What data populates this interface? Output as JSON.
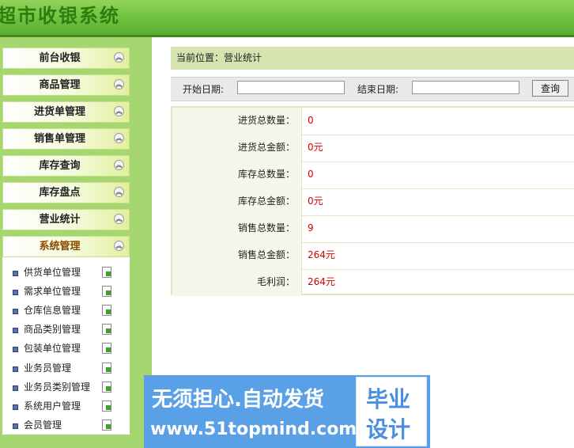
{
  "header": {
    "title": "超市收银系统"
  },
  "sidebar": {
    "items": [
      {
        "label": "前台收银"
      },
      {
        "label": "商品管理"
      },
      {
        "label": "进货单管理"
      },
      {
        "label": "销售单管理"
      },
      {
        "label": "库存查询"
      },
      {
        "label": "库存盘点"
      },
      {
        "label": "营业统计"
      },
      {
        "label": "系统管理"
      }
    ],
    "toggle_glyph": "︽",
    "submenu": [
      {
        "label": "供货单位管理"
      },
      {
        "label": "需求单位管理"
      },
      {
        "label": "仓库信息管理"
      },
      {
        "label": "商品类别管理"
      },
      {
        "label": "包装单位管理"
      },
      {
        "label": "业务员管理"
      },
      {
        "label": "业务员类别管理"
      },
      {
        "label": "系统用户管理"
      },
      {
        "label": "会员管理"
      }
    ]
  },
  "breadcrumb": "当前位置：营业统计",
  "search": {
    "start_label": "开始日期:",
    "end_label": "结束日期:",
    "start_value": "",
    "end_value": "",
    "button": "查询"
  },
  "stats": [
    {
      "label": "进货总数量：",
      "value": "0"
    },
    {
      "label": "进货总金额：",
      "value": "0元"
    },
    {
      "label": "库存总数量：",
      "value": "0"
    },
    {
      "label": "库存总金额：",
      "value": "0元"
    },
    {
      "label": "销售总数量：",
      "value": "9"
    },
    {
      "label": "销售总金额：",
      "value": "264元"
    },
    {
      "label": "毛利润：",
      "value": "264元"
    }
  ],
  "watermark": {
    "line1": "无须担心.自动发货",
    "line2": "www.51topmind.com",
    "box1": "毕业",
    "box2": "设计"
  },
  "colors": {
    "header": "#6cbf3c",
    "sidebar": "#a6d66f",
    "value_red": "#d00000",
    "breadcrumb_bg": "#d5e3b0"
  }
}
